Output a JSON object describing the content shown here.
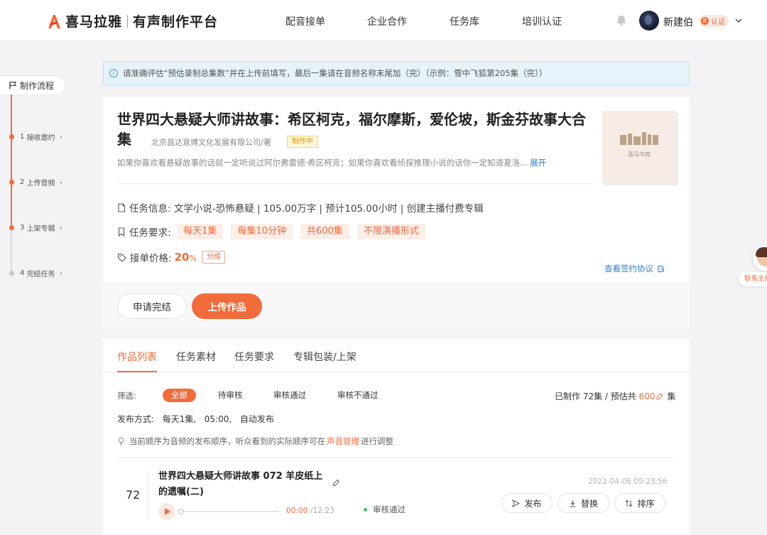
{
  "header": {
    "brand": "喜马拉雅",
    "platform": "有声制作平台",
    "nav": [
      "配音接单",
      "企业合作",
      "任务库",
      "培训认证"
    ],
    "username": "新建伯",
    "cert_label": "认证",
    "cert_mark": "R"
  },
  "sidebar": {
    "title": "制作流程",
    "steps": [
      {
        "num": "1",
        "label": "接收邀约"
      },
      {
        "num": "2",
        "label": "上传音频"
      },
      {
        "num": "3",
        "label": "上架专辑"
      },
      {
        "num": "4",
        "label": "完结任务"
      }
    ],
    "chevron": "›"
  },
  "notice": {
    "icon": "i",
    "text": "请准确评估“预估录制总集数”并在上传前填写，最后一集请在音频名称末尾加（完）（示例：雪中飞狐第205集（完））"
  },
  "task": {
    "title": "世界四大悬疑大师讲故事：希区柯克，福尔摩斯，爱伦坡，斯金芬故事大合集",
    "publisher": "北京昌达意博文化发展有限公司/著",
    "status": "制作中",
    "description": "如果你喜欢看悬疑故事的话就一定听说过阿尔弗雷德·希区柯克；如果你喜欢看侦探推理小说的话你一定知道夏洛...",
    "expand_label": "展开",
    "cover_label": "喜马书库",
    "info_label": "任务信息:",
    "info_value": "文学小说-恐怖悬疑 | 105.00万字 | 预计105.00小时 | 创建主播付费专辑",
    "req_label": "任务要求:",
    "requirements": [
      "每天1集",
      "每集10分钟",
      "共600集",
      "不限演播形式"
    ],
    "price_label": "接单价格:",
    "price_value": "20",
    "price_unit": "%",
    "price_type": "分成",
    "contract_link": "查看签约协议",
    "btn_finish": "申请完结",
    "btn_upload": "上传作品"
  },
  "float_contact": {
    "label": "联系主播"
  },
  "works": {
    "tabs": [
      "作品列表",
      "任务素材",
      "任务要求",
      "专辑包装/上架"
    ],
    "filter_label": "筛选:",
    "filters": [
      "全部",
      "待审核",
      "审核通过",
      "审核不通过"
    ],
    "made_prefix": "已制作 72集 / 预估共",
    "estimate": "600",
    "made_suffix": "集",
    "publish_mode_label": "发布方式:",
    "publish_mode": [
      "每天1集,",
      "05:00,",
      "自动发布"
    ],
    "tip_prefix": "当前顺序为音频的发布顺序，听众看到的实际顺序可在",
    "tip_link": "声音管理",
    "tip_suffix": "进行调整",
    "episode": {
      "number": "72",
      "title": "世界四大悬疑大师讲故事 072 羊皮纸上的遗嘱(二)",
      "date": "2022-04-06 09:23:56",
      "time_current": "00:00",
      "time_total": "/12:23",
      "progress": 0,
      "review_status": "审核通过",
      "actions": [
        "发布",
        "替换",
        "排序"
      ]
    }
  },
  "colors": {
    "accent": "#f26b3a",
    "link": "#2f7fd8",
    "success": "#3fbf6a"
  }
}
